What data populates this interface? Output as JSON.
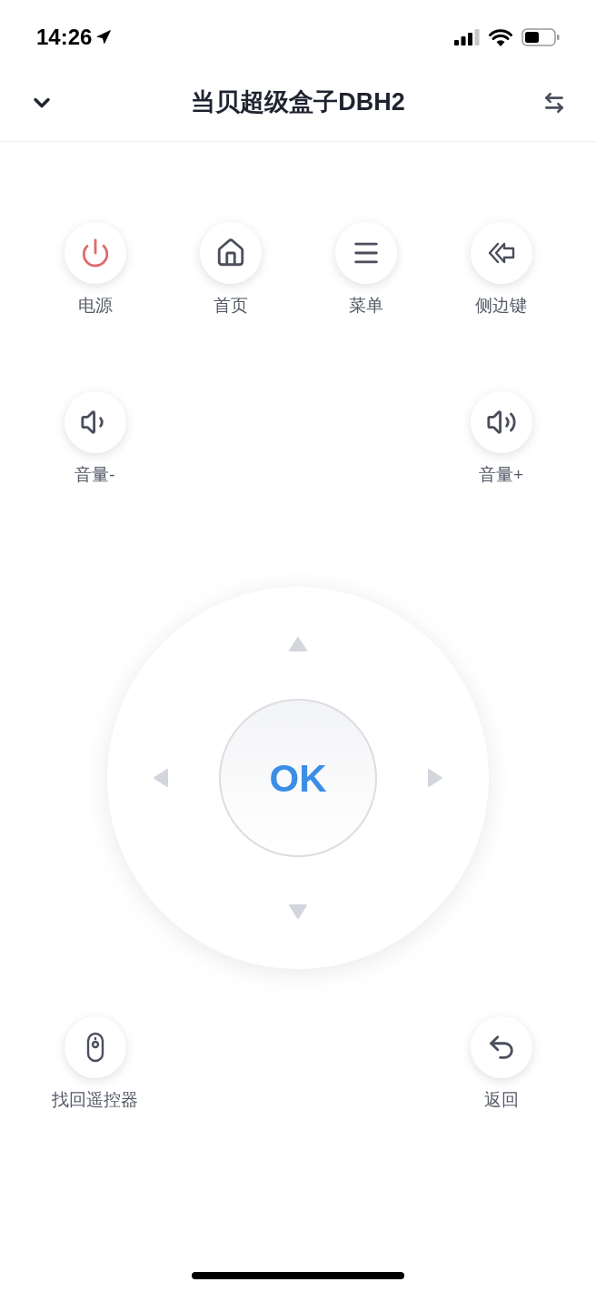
{
  "status_bar": {
    "time": "14:26"
  },
  "header": {
    "title": "当贝超级盒子DBH2"
  },
  "top_buttons": [
    {
      "kind": "power",
      "label": "电源"
    },
    {
      "kind": "home",
      "label": "首页"
    },
    {
      "kind": "menu",
      "label": "菜单"
    },
    {
      "kind": "side",
      "label": "侧边键"
    }
  ],
  "volume_buttons": [
    {
      "kind": "volume_down",
      "label": "音量-"
    },
    {
      "kind": "volume_up",
      "label": "音量+"
    }
  ],
  "dpad": {
    "ok_label": "OK"
  },
  "bottom_buttons": [
    {
      "kind": "find",
      "label": "找回遥控器"
    },
    {
      "kind": "back",
      "label": "返回"
    }
  ]
}
